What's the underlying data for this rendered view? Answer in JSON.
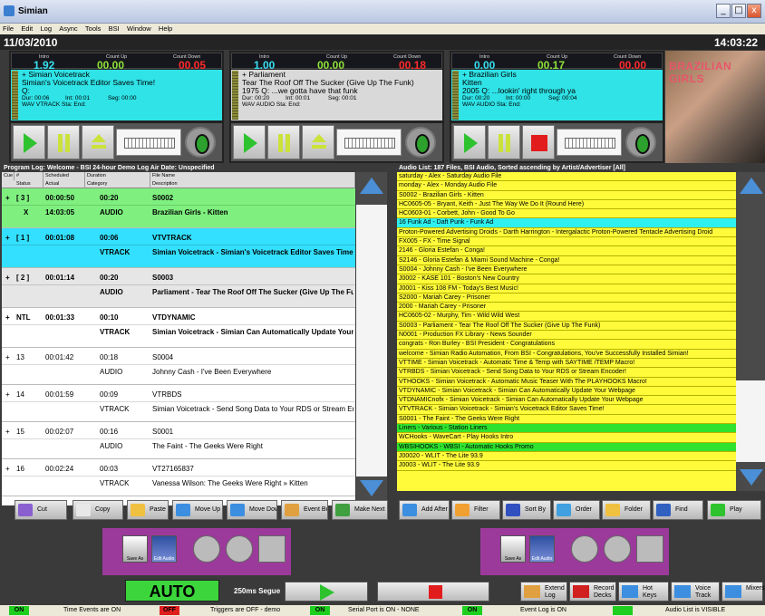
{
  "window": {
    "title": "Simian",
    "min": "_",
    "max": "□",
    "close": "x"
  },
  "menu": [
    "File",
    "Edit",
    "Log",
    "Async",
    "Tools",
    "BSI",
    "Window",
    "Help"
  ],
  "date": "11/03/2010",
  "time": "14:03:22",
  "decks": [
    {
      "intro": "1.92",
      "countup": "00.00",
      "countdown": "00.05",
      "artist": "+  Simian Voicetrack",
      "title": "Simian's Voicetrack Editor Saves Time!",
      "q": "Q:",
      "dur": "Dur: 00:06",
      "int": "Int: 00:01",
      "seg": "Seg: 00:00",
      "type": "WAV  VTRACK  Sta:   End:"
    },
    {
      "intro": "1.00",
      "countup": "00.00",
      "countdown": "00.18",
      "artist": "+  Parliament",
      "title": "Tear The Roof Off The Sucker (Give Up The Funk)",
      "q": "1975    Q:   ...we gotta have that funk",
      "dur": "Dur: 00:20",
      "int": "Int: 00:01",
      "seg": "Seg: 00:01",
      "type": "WAV  AUDIO  Sta:   End:"
    },
    {
      "intro": "0.00",
      "countup": "00.17",
      "countdown": "00.00",
      "artist": "+  Brazilian Girls",
      "title": "Kitten",
      "q": "2005    Q:   ...lookin' right through ya",
      "dur": "Dur: 00:20",
      "int": "Int: 00:00",
      "seg": "Seg: 00:04",
      "type": "WAV  AUDIO  Sta:   End:"
    }
  ],
  "labels": {
    "intro": "Intro",
    "countup": "Count Up",
    "countdown": "Count Down"
  },
  "albumart": "BRAZILIAN GIRLS",
  "program_log": {
    "title": "Program Log: Welcome - BSI 24-hour Demo Log   Air Date: Unspecified",
    "cols1": [
      "Cue",
      "#",
      "Scheduled",
      "Duration",
      "File Name"
    ],
    "cols2": [
      "Status",
      "Actual",
      "Category",
      "Description"
    ],
    "rows": [
      {
        "cue": "+",
        "num": "[ 3 ]",
        "sched": "00:00:50",
        "dur": "00:20",
        "file": "S0002",
        "status": "X",
        "actual": "14:03:05",
        "cat": "AUDIO",
        "desc": "Brazilian Girls - Kitten"
      },
      {
        "cue": "+",
        "num": "[ 1 ]",
        "sched": "00:01:08",
        "dur": "00:06",
        "file": "VTVTRACK",
        "status": "",
        "actual": "",
        "cat": "VTRACK",
        "desc": "Simian Voicetrack - Simian's Voicetrack Editor Saves Time!"
      },
      {
        "cue": "+",
        "num": "[ 2 ]",
        "sched": "00:01:14",
        "dur": "00:20",
        "file": "S0003",
        "status": "",
        "actual": "",
        "cat": "AUDIO",
        "desc": "Parliament - Tear The Roof Off The Sucker (Give Up The Funk)"
      },
      {
        "cue": "+",
        "num": "NTL",
        "sched": "00:01:33",
        "dur": "00:10",
        "file": "VTDYNAMIC",
        "status": "",
        "actual": "",
        "cat": "VTRACK",
        "desc": "Simian Voicetrack - Simian Can Automatically Update Your Webpage"
      },
      {
        "cue": "+",
        "num": "13",
        "sched": "00:01:42",
        "dur": "00:18",
        "file": "S0004",
        "status": "",
        "actual": "",
        "cat": "AUDIO",
        "desc": "Johnny Cash - I've Been Everywhere"
      },
      {
        "cue": "+",
        "num": "14",
        "sched": "00:01:59",
        "dur": "00:09",
        "file": "VTRBDS",
        "status": "",
        "actual": "",
        "cat": "VTRACK",
        "desc": "Simian Voicetrack - Send Song Data to Your RDS or Stream Encoder!"
      },
      {
        "cue": "+",
        "num": "15",
        "sched": "00:02:07",
        "dur": "00:16",
        "file": "S0001",
        "status": "",
        "actual": "",
        "cat": "AUDIO",
        "desc": "The Faint - The Geeks Were Right"
      },
      {
        "cue": "+",
        "num": "16",
        "sched": "00:02:24",
        "dur": "00:03",
        "file": "VT27165837",
        "status": "",
        "actual": "",
        "cat": "VTRACK",
        "desc": "Vanessa Wilson:  The Geeks Were Right » Kitten"
      }
    ]
  },
  "audio_list": {
    "title": "Audio List: 187 Files, BSI Audio, Sorted ascending by Artist/Advertiser [All]",
    "rows": [
      "saturday - Alex - Saturday Audio File",
      "monday - Alex - Monday Audio File",
      "S0002 - Brazilian Girls - Kitten",
      "HC0605-05 - Bryant, Keith - Just The Way We Do It (Round Here)",
      "HC0603-01 - Corbett, John - Good To Go",
      "16 Funk Ad - Daft Punk - Funk Ad",
      "Proton-Powered Advertising Droids - Darth Harrington - Intergalactic Proton-Powered Tentacle Advertising Droid",
      "FX005 - FX - Time Signal",
      "2146 - Gloria Estefan - Conga!",
      "S2146 - Gloria Estefan & Miami Sound Machine - Conga!",
      "S0004 - Johnny Cash - I've Been Everywhere",
      "J0002 - KASE 101 - Boston's New Country",
      "J0001 - Kiss 108 FM - Today's Best Music!",
      "S2000 - Mariah Carey - Prisoner",
      "2000 - Mariah Carey - Prisoner",
      "HC0605-02 - Murphy, Tim - Wild Wild West",
      "S0003 - Parliament - Tear The Roof Off The Sucker (Give Up The Funk)",
      "N0001 - Production FX Library - News Sounder",
      "congrats - Ron Burley - BSI President - Congratulations",
      "welcome - Simian Radio Automation, From BSI - Congratulations, You've Successfully Installed Simian!",
      "VTTIME - Simian Voicetrack - Automatic Time & Temp with SAYTIME /TEMP Macro!",
      "VTRBDS - Simian Voicetrack - Send Song Data to Your RDS or Stream Encoder!",
      "VTHOOKS - Simian Voicetrack - Automatic Music Teaser With The PLAYHOOKS Macro!",
      "VTDYNAMIC - Simian Voicetrack - Simian Can Automatically Update Your Webpage",
      "VTDNAMICnofx - Simian Voicetrack - Simian Can Automatically Update Your Webpage",
      "VTVTRACK - Simian Voicetrack - Simian's Voicetrack Editor Saves Time!",
      "S0001 - The Faint - The Geeks Were Right",
      "Liners - Various - Station Liners",
      "WCHooks - WaveCart - Play Hooks Intro",
      "WBSIHOOKS - WBSI - Automatic Hooks Promo",
      "J00020 - WLIT - The Lite 93.9",
      "J0003 - WLIT - The Lite 93.9"
    ]
  },
  "log_toolbar": [
    "Cut",
    "Copy",
    "Paste",
    "Move Up",
    "Move Down",
    "Event Builder",
    "Make Next"
  ],
  "audio_toolbar": [
    "Add After",
    "Filter",
    "Sort By",
    "Order",
    "Folder",
    "Find",
    "Play"
  ],
  "lower": {
    "saveas": "Save As",
    "editaudio": "Edit Audio"
  },
  "auto": "AUTO",
  "segue": "250ms Segue",
  "bottom_buttons": [
    "Extend Log",
    "Record Decks",
    "Hot Keys",
    "Voice Track",
    "Mixers"
  ],
  "status": [
    {
      "tag": "ON",
      "text": "Time Events are ON",
      "color": "#1fcf1f"
    },
    {
      "tag": "OFF",
      "text": "Triggers are OFF - demo",
      "color": "#e01e1e"
    },
    {
      "tag": "ON",
      "text": "Serial Port is ON - NONE",
      "color": "#1fcf1f"
    },
    {
      "tag": "ON",
      "text": "Event Log is ON",
      "color": "#1fcf1f"
    },
    {
      "tag": "",
      "text": "Audio List is VISIBLE",
      "color": "#1fcf1f"
    }
  ]
}
